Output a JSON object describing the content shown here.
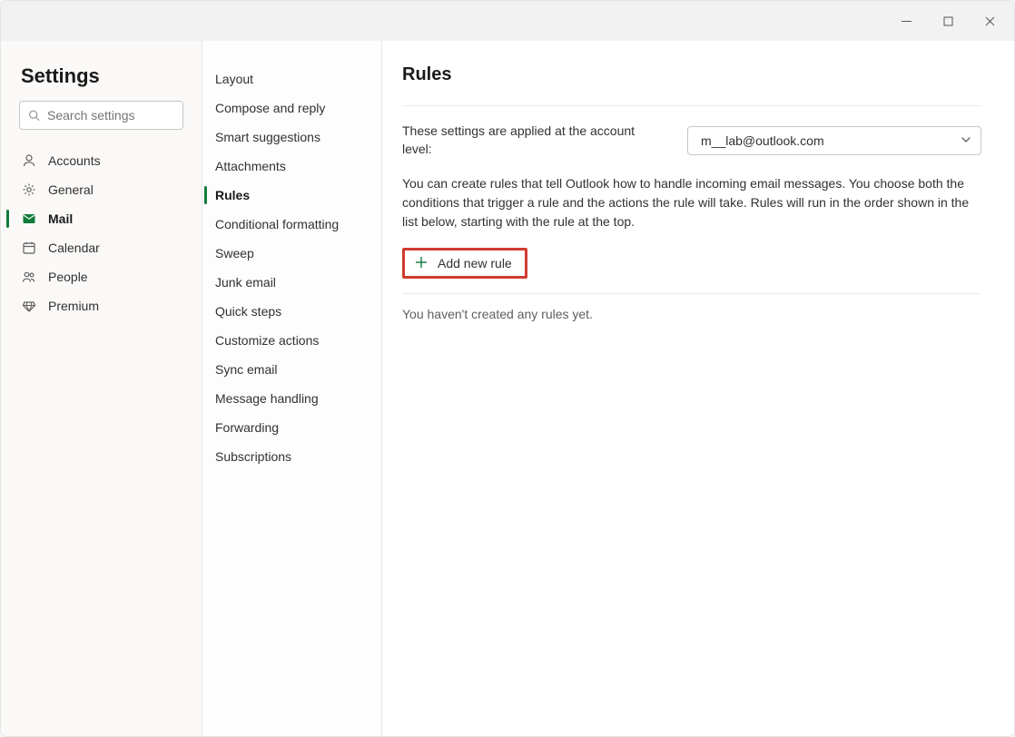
{
  "window": {
    "controls": {
      "minimize": "–",
      "maximize": "☐",
      "close": "✕"
    }
  },
  "sidebar": {
    "title": "Settings",
    "search_placeholder": "Search settings",
    "items": [
      {
        "icon": "person",
        "label": "Accounts"
      },
      {
        "icon": "gear",
        "label": "General"
      },
      {
        "icon": "mail",
        "label": "Mail",
        "active": true
      },
      {
        "icon": "calendar",
        "label": "Calendar"
      },
      {
        "icon": "people",
        "label": "People"
      },
      {
        "icon": "premium",
        "label": "Premium"
      }
    ]
  },
  "subnav": {
    "items": [
      {
        "label": "Layout"
      },
      {
        "label": "Compose and reply"
      },
      {
        "label": "Smart suggestions"
      },
      {
        "label": "Attachments"
      },
      {
        "label": "Rules",
        "active": true
      },
      {
        "label": "Conditional formatting"
      },
      {
        "label": "Sweep"
      },
      {
        "label": "Junk email"
      },
      {
        "label": "Quick steps"
      },
      {
        "label": "Customize actions"
      },
      {
        "label": "Sync email"
      },
      {
        "label": "Message handling"
      },
      {
        "label": "Forwarding"
      },
      {
        "label": "Subscriptions"
      }
    ]
  },
  "main": {
    "title": "Rules",
    "account_intro": "These settings are applied at the account level:",
    "account_selected": "m__lab@outlook.com",
    "description": "You can create rules that tell Outlook how to handle incoming email messages. You choose both the conditions that trigger a rule and the actions the rule will take. Rules will run in the order shown in the list below, starting with the rule at the top.",
    "add_button": "Add new rule",
    "empty_state": "You haven't created any rules yet."
  }
}
